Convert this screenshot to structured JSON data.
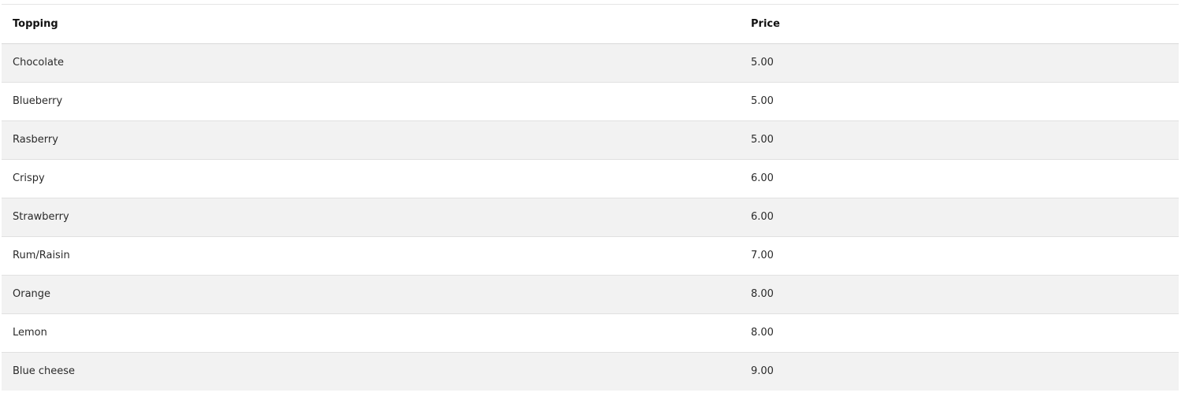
{
  "table": {
    "headers": [
      "Topping",
      "Price"
    ],
    "rows": [
      [
        "Chocolate",
        "5.00"
      ],
      [
        "Blueberry",
        "5.00"
      ],
      [
        "Rasberry",
        "5.00"
      ],
      [
        "Crispy",
        "6.00"
      ],
      [
        "Strawberry",
        "6.00"
      ],
      [
        "Rum/Raisin",
        "7.00"
      ],
      [
        "Orange",
        "8.00"
      ],
      [
        "Lemon",
        "8.00"
      ],
      [
        "Blue cheese",
        "9.00"
      ]
    ]
  }
}
